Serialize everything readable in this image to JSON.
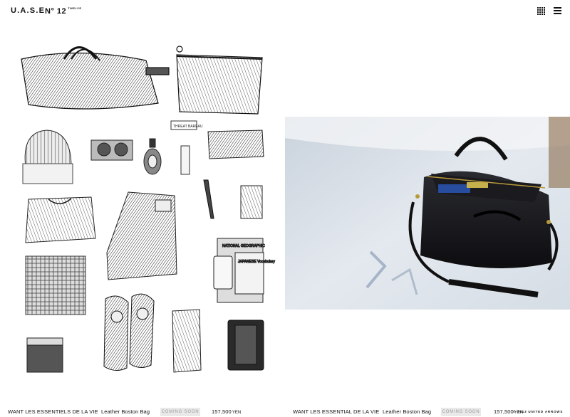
{
  "header": {
    "brand": "U.A.S.E",
    "issue_number": "N° 12",
    "issue_word": "TWELVE"
  },
  "icons": {
    "grid": "grid-view-icon",
    "menu": "hamburger-menu-icon"
  },
  "items": [
    {
      "brand": "WANT LES ESSENTIELS DE LA VIE",
      "product": "Leather Boston Bag",
      "status": "COMING SOON",
      "price": "157,500",
      "currency": "YEN"
    },
    {
      "brand": "WANT LES ESSENTIAL DE LA VIE",
      "product": "Leather Boston Bag",
      "status": "COMING SOON",
      "price": "157,500",
      "currency": "YEN"
    }
  ],
  "illustration_labels": {
    "magazine": "NATIONAL GEOGRAPHIC",
    "book": "JAPANESE Vocabulary",
    "tag": "THREAT BAREAU"
  },
  "footer": {
    "copyright": "© 2013 UNITED ARROWS"
  },
  "colors": {
    "badge_bg": "#e9e9e9",
    "badge_text": "#9a9a9a",
    "text": "#111111"
  }
}
